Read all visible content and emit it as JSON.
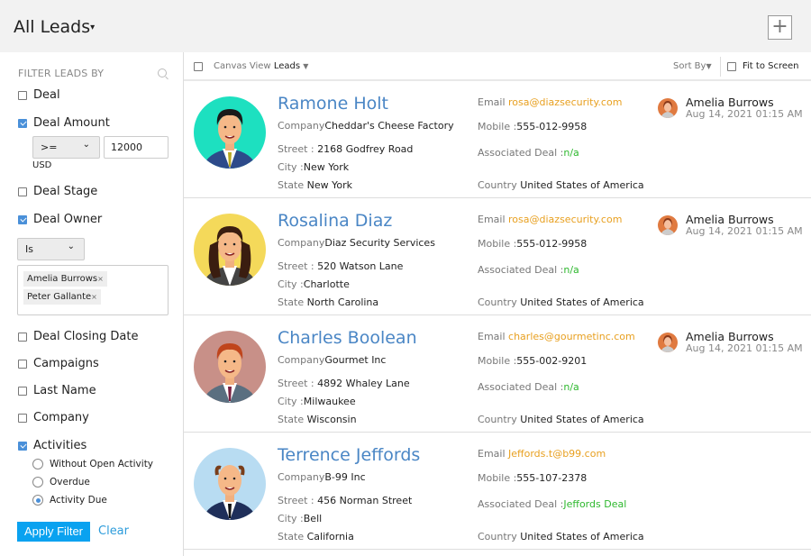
{
  "header": {
    "title": "All Leads",
    "add_icon": "plus-icon"
  },
  "sidebar": {
    "heading": "FILTER LEADS BY",
    "filters": [
      {
        "label": "Deal",
        "checked": false
      },
      {
        "label": "Deal Amount",
        "checked": true
      },
      {
        "label": "Deal Stage",
        "checked": false
      },
      {
        "label": "Deal Owner",
        "checked": true
      },
      {
        "label": "Deal Closing Date",
        "checked": false
      },
      {
        "label": "Campaigns",
        "checked": false
      },
      {
        "label": "Last Name",
        "checked": false
      },
      {
        "label": "Company",
        "checked": false
      },
      {
        "label": "Activities",
        "checked": true
      }
    ],
    "amount_operator": ">=",
    "amount_value": "12000",
    "currency": "USD",
    "owner_operator": "Is",
    "owner_tags": [
      "Amelia Burrows",
      "Peter Gallante"
    ],
    "activity_options": [
      {
        "label": "Without Open Activity",
        "selected": false
      },
      {
        "label": "Overdue",
        "selected": false
      },
      {
        "label": "Activity Due",
        "selected": true
      }
    ],
    "apply_label": "Apply Filter",
    "clear_label": "Clear"
  },
  "toolbar": {
    "view_label": "Canvas View",
    "module": "Leads",
    "sort_label": "Sort By",
    "fit_label": "Fit to Screen"
  },
  "labels": {
    "company": "Company",
    "street": "Street :",
    "city": "City :",
    "state": "State",
    "email": "Email",
    "mobile": "Mobile :",
    "deal": "Associated Deal :",
    "country": "Country"
  },
  "colors": {
    "name": "#4a86c5",
    "email": "#e8a020",
    "deal": "#2eb82e",
    "apply": "#0aa2f0"
  },
  "leads": [
    {
      "name": "Ramone Holt",
      "company": "Cheddar's Cheese Factory",
      "street": "2168 Godfrey Road",
      "city": "New York",
      "state": "New York",
      "email": "rosa@diazsecurity.com",
      "mobile": "555-012-9958",
      "deal": "n/a",
      "country": "United States of America",
      "owner": "Amelia Burrows",
      "date": "Aug 14, 2021 01:15 AM",
      "avatar_bg": "#1de0c0"
    },
    {
      "name": "Rosalina Diaz",
      "company": "Diaz Security Services",
      "street": "520 Watson Lane",
      "city": "Charlotte",
      "state": "North Carolina",
      "email": "rosa@diazsecurity.com",
      "mobile": "555-012-9958",
      "deal": "n/a",
      "country": "United States of America",
      "owner": "Amelia Burrows",
      "date": "Aug 14, 2021 01:15 AM",
      "avatar_bg": "#f4d95a"
    },
    {
      "name": "Charles Boolean",
      "company": "Gourmet Inc",
      "street": "4892 Whaley Lane",
      "city": "Milwaukee",
      "state": "Wisconsin",
      "email": "charles@gourmetinc.com",
      "mobile": "555-002-9201",
      "deal": "n/a",
      "country": "United States of America",
      "owner": "Amelia Burrows",
      "date": "Aug 14, 2021 01:15 AM",
      "avatar_bg": "#c89088"
    },
    {
      "name": "Terrence Jeffords",
      "company": "B-99 Inc",
      "street": "456 Norman Street",
      "city": "Bell",
      "state": "California",
      "email": "Jeffords.t@b99.com",
      "mobile": "555-107-2378",
      "deal": "Jeffords Deal",
      "country": "United States of America",
      "owner": "",
      "date": "",
      "avatar_bg": "#b8dcf2"
    }
  ]
}
